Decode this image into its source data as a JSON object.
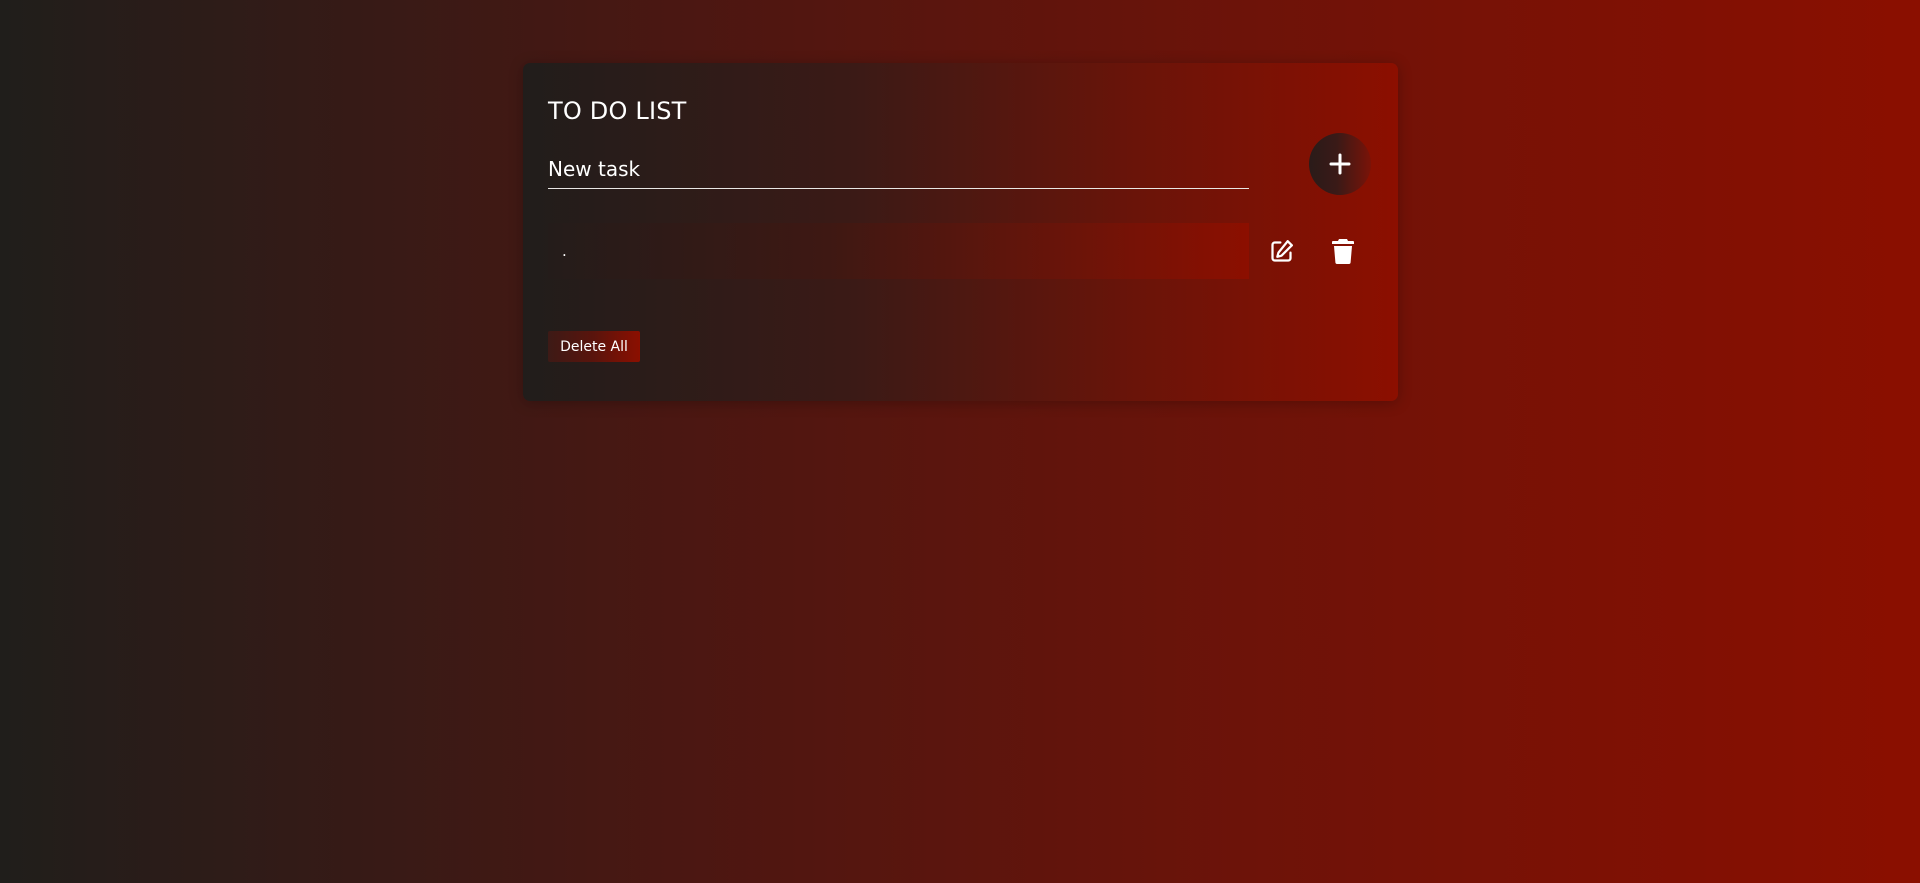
{
  "app": {
    "title": "TO DO LIST"
  },
  "new_task": {
    "placeholder": "New task",
    "value": "",
    "add_icon": "plus-icon"
  },
  "tasks": [
    {
      "text": ".",
      "edit_icon": "edit-icon",
      "delete_icon": "trash-icon"
    }
  ],
  "actions": {
    "delete_all_label": "Delete All"
  },
  "colors": {
    "background_start": "#201e1b",
    "background_end": "#8b0f00",
    "text": "#ffffff"
  }
}
